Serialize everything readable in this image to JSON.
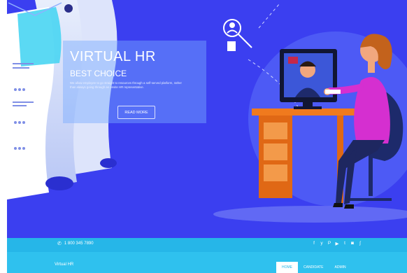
{
  "hero": {
    "title": "VIRTUAL HR",
    "subtitle": "BEST CHOICE",
    "description": "We allow employee to go straight to resources through a self-served platform, rather than always going through an onsite HR representative.",
    "button_label": "READ MORE"
  },
  "topbar": {
    "phone_icon": "phone-icon",
    "phone": "1 800 345 7890",
    "social_icons": [
      "facebook-icon",
      "twitter-icon",
      "pinterest-icon",
      "youtube-icon",
      "tumblr-icon",
      "instagram-icon",
      "rss-icon"
    ],
    "social_glyphs": [
      "f",
      "y",
      "P",
      "▶",
      "t",
      "◙",
      "ʃ"
    ]
  },
  "navbar": {
    "brand": "Virtual HR",
    "items": [
      {
        "label": "HOME",
        "active": true
      },
      {
        "label": "CANDIDATE",
        "active": false
      },
      {
        "label": "ADMIN",
        "active": false
      }
    ]
  },
  "colors": {
    "hero_bg": "#3b3ff0",
    "bar": "#26b6e8",
    "nav": "#2fc1ee",
    "accent_orange": "#f07a1e",
    "accent_pink": "#d52fd0"
  }
}
